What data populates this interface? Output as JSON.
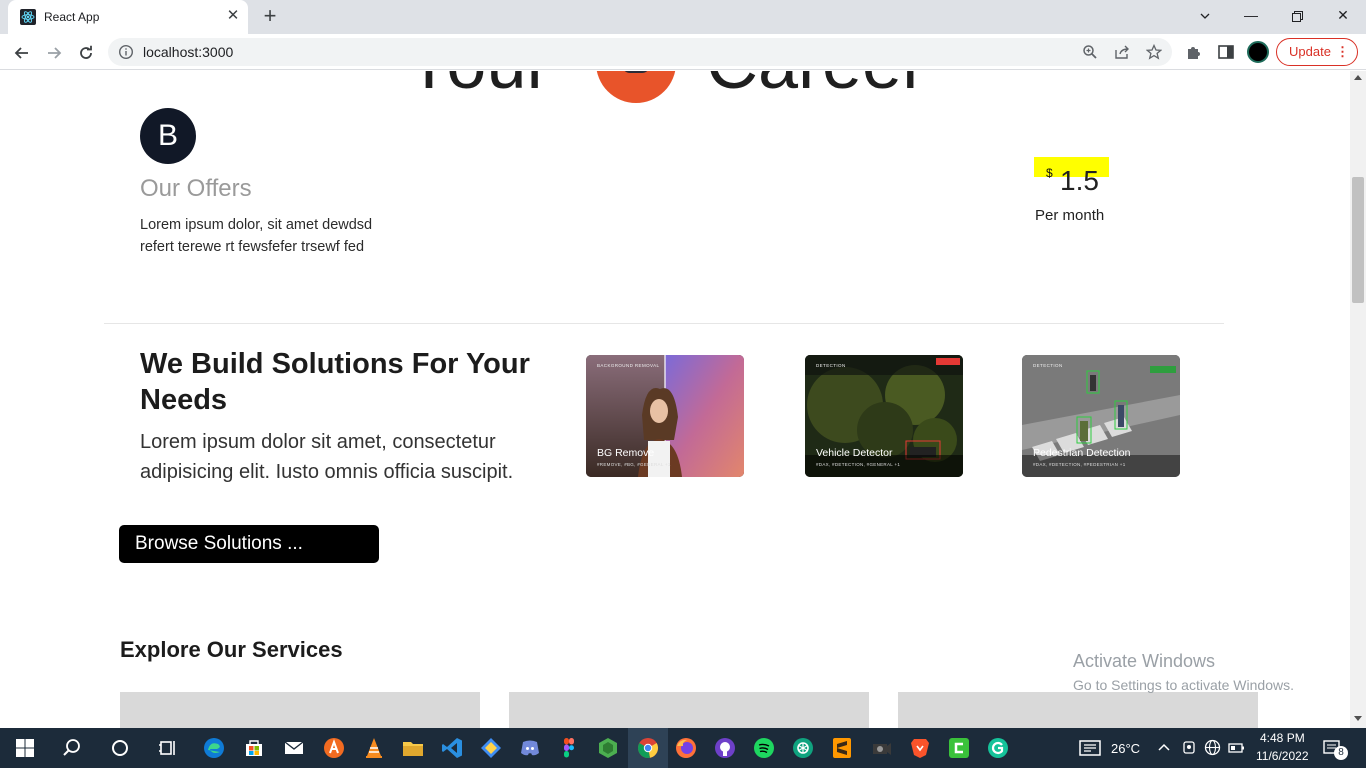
{
  "browser": {
    "tab_title": "React App",
    "url": "localhost:3000",
    "update_label": "Update"
  },
  "hero": {
    "word1": "Your",
    "word2": "Career"
  },
  "offers": {
    "avatar_letter": "B",
    "title": "Our Offers",
    "description": "Lorem ipsum dolor, sit amet dewdsd refert terewe rt fewsfefer trsewf fed"
  },
  "pricing": {
    "currency": "$",
    "amount": "1.5",
    "period": "Per month"
  },
  "solutions": {
    "title": "We Build Solutions For Your Needs",
    "description": "Lorem ipsum dolor sit amet, consectetur adipisicing elit. Iusto omnis officia suscipit.",
    "browse_label": "Browse Solutions ...",
    "cards": [
      {
        "label": "BG Remove",
        "category": "BACKGROUND REMOVAL",
        "tags": "#REMOVE, #BG, #GENERAL +1"
      },
      {
        "label": "Vehicle Detector",
        "category": "DETECTION",
        "tags": "#DAX, #DETECTION, #GENERAL +1"
      },
      {
        "label": "Pedestrian Detection",
        "category": "DETECTION",
        "tags": "#DAX, #DETECTION, #PEDESTRIAN +1"
      }
    ]
  },
  "services": {
    "title": "Explore Our Services"
  },
  "activation": {
    "line1": "Activate Windows",
    "line2": "Go to Settings to activate Windows."
  },
  "taskbar": {
    "temperature": "26°C",
    "time": "4:48 PM",
    "date": "11/6/2022",
    "notifications": "8"
  },
  "colors": {
    "price_highlight": "#ffff00",
    "update_red": "#d93025",
    "taskbar_bg": "#1c2b3a"
  }
}
